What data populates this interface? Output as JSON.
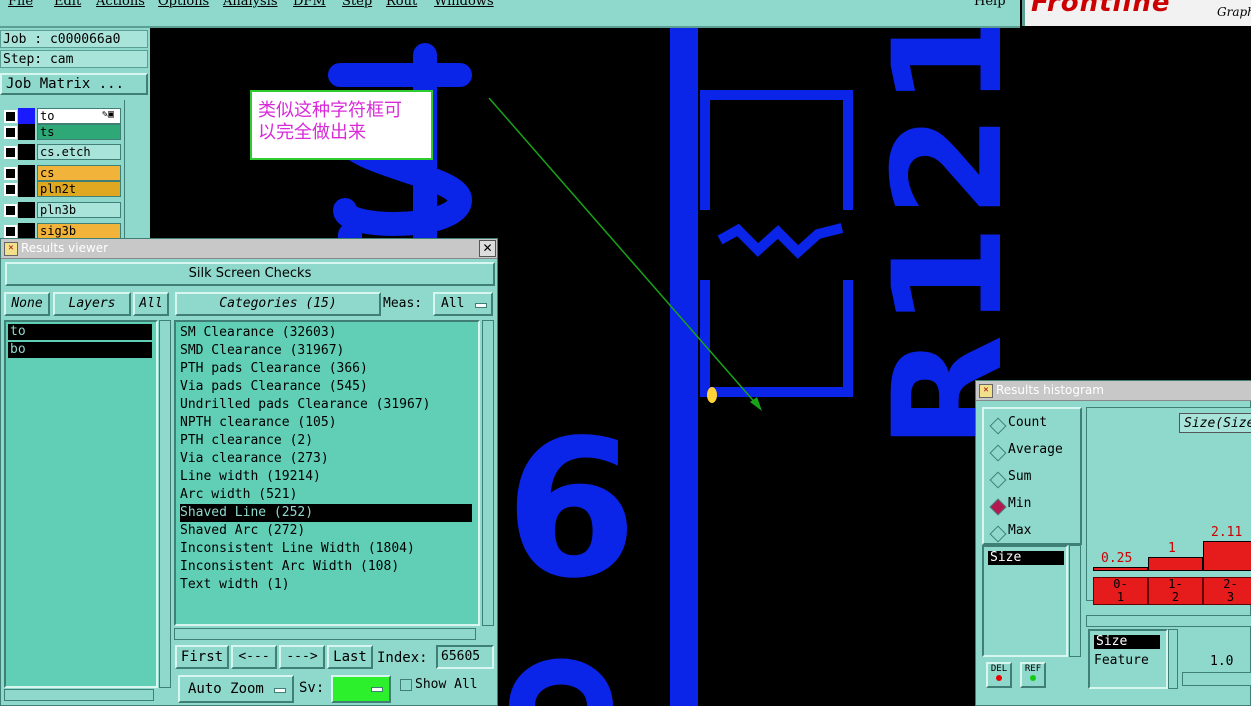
{
  "menubar": {
    "items": [
      "File",
      "Edit",
      "Actions",
      "Options",
      "Analysis",
      "DFM",
      "Step",
      "Rout",
      "Windows"
    ],
    "help": "Help"
  },
  "logo": {
    "brand": "Frontline",
    "graph": "Graph"
  },
  "job": {
    "job_line": "Job : c000066a0",
    "step_line": "Step: cam",
    "matrix_button": "Job Matrix ..."
  },
  "layers": [
    {
      "name": "to",
      "color": "#ffffff"
    },
    {
      "name": "ts",
      "color": "#2fa878"
    },
    {
      "name": "cs.etch",
      "color": "#a9e4da"
    },
    {
      "name": "cs",
      "color": "#f2b33a"
    },
    {
      "name": "pln2t",
      "color": "#e0a820"
    },
    {
      "name": "pln3b",
      "color": "#a9e4da"
    },
    {
      "name": "sig3b",
      "color": "#f2b33a"
    }
  ],
  "annotation": {
    "text": "类似这种字符框可以完全做出来",
    "text_line1": "类似这种字符框可",
    "text_line2": "以完全做出来"
  },
  "canvas": {
    "texts": [
      "R121",
      "6"
    ]
  },
  "results_viewer": {
    "title": "Results viewer",
    "header": "Silk Screen Checks",
    "none_btn": "None",
    "layers_label": "Layers",
    "all_btn": "All",
    "layer_entries": [
      "to",
      "bo"
    ],
    "categories_label": "Categories (15)",
    "meas_label": "Meas:",
    "meas_value": "All",
    "categories": [
      "SM Clearance (32603)",
      "SMD Clearance (31967)",
      "PTH pads Clearance (366)",
      "Via pads Clearance (545)",
      "Undrilled pads Clearance (31967)",
      "NPTH clearance (105)",
      "PTH clearance (2)",
      "Via clearance (273)",
      "Line width (19214)",
      "Arc width (521)",
      "Shaved Line (252)",
      "Shaved Arc (272)",
      "Inconsistent Line Width (1804)",
      "Inconsistent Arc Width (108)",
      "Text width (1)"
    ],
    "selected_index": 10,
    "nav": {
      "first": "First",
      "prev": "<---",
      "next": "--->",
      "last": "Last",
      "index_label": "Index:",
      "index_value": "65605"
    },
    "auto_zoom": "Auto Zoom",
    "sv_label": "Sv:",
    "show_all": "Show All"
  },
  "histogram": {
    "title": "Results histogram",
    "modes": [
      "Count",
      "Average",
      "Sum",
      "Min",
      "Max"
    ],
    "selected_mode": "Min",
    "size_header": "Size(Size",
    "list_item": "Size",
    "chart_data": {
      "type": "bar",
      "categories": [
        "0-1",
        "1-2",
        "2-3"
      ],
      "values": [
        0.25,
        1,
        2.11
      ],
      "value_labels": [
        "0.25",
        "1",
        "2.11"
      ],
      "bin_labels": [
        [
          "0-",
          "1"
        ],
        [
          "1-",
          "2"
        ],
        [
          "2-",
          "3"
        ]
      ]
    },
    "del_btn": "DEL",
    "ref_btn": "REF",
    "sort_items": [
      "Size",
      "Feature"
    ],
    "scale_value": "1.0"
  }
}
